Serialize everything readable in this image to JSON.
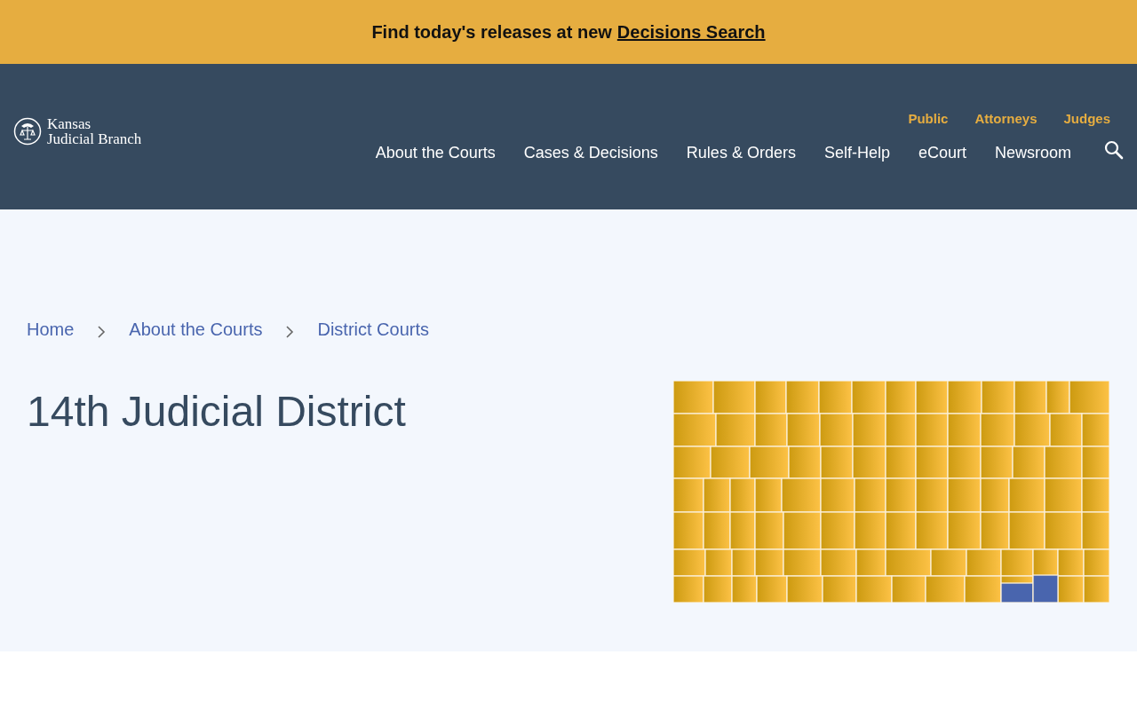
{
  "banner": {
    "text": "Find today's releases at new",
    "link": "Decisions Search"
  },
  "header": {
    "logo_lines": [
      "Kansas",
      "Judicial Branch"
    ],
    "audience_links": [
      "Public",
      "Attorneys",
      "Judges"
    ],
    "nav": [
      "About the Courts",
      "Cases & Decisions",
      "Rules & Orders",
      "Self-Help",
      "eCourt",
      "Newsroom"
    ]
  },
  "breadcrumb": [
    "Home",
    "About the Courts",
    "District Courts"
  ],
  "page_title": "14th Judicial District"
}
